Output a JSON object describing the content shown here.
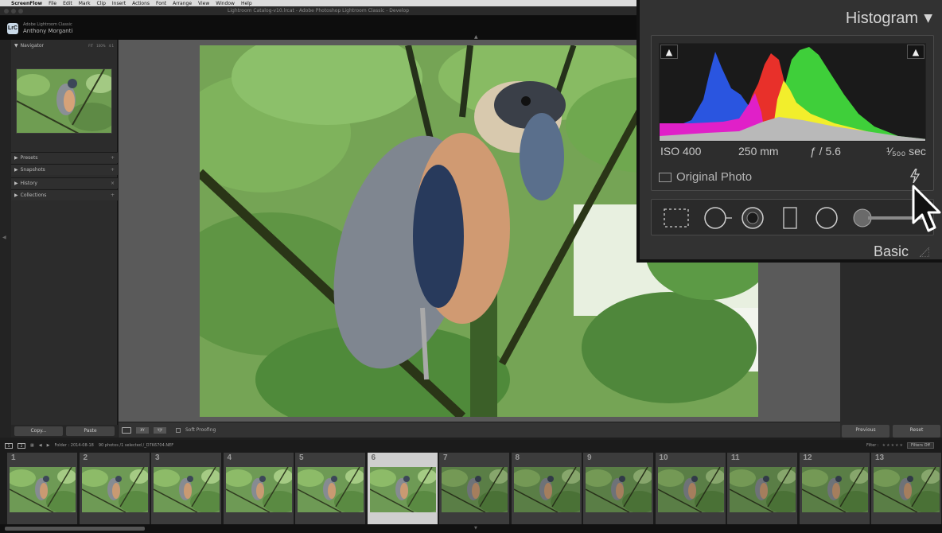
{
  "menubar": {
    "apple": "",
    "app": "ScreenFlow",
    "items": [
      "File",
      "Edit",
      "Mark",
      "Clip",
      "Insert",
      "Actions",
      "Font",
      "Arrange",
      "View",
      "Window",
      "Help"
    ]
  },
  "window": {
    "title": "Lightroom Catalog-v10.lrcat - Adobe Photoshop Lightroom Classic - Develop"
  },
  "identity": {
    "badge": "LrC",
    "app": "Adobe Lightroom Classic",
    "user": "Anthony Morganti"
  },
  "navigator": {
    "title": "Navigator",
    "zooms": [
      "FIT",
      "100%",
      "4:1"
    ]
  },
  "left_sections": [
    {
      "label": "Presets"
    },
    {
      "label": "Snapshots"
    },
    {
      "label": "History"
    },
    {
      "label": "Collections"
    }
  ],
  "left_buttons": {
    "copy": "Copy...",
    "paste": "Paste"
  },
  "toolbar": {
    "soft_proofing": "Soft Proofing",
    "compare": "XY",
    "survey": "Y|Y"
  },
  "right_buttons": {
    "previous": "Previous",
    "reset": "Reset"
  },
  "histogram": {
    "title": "Histogram",
    "clip_shadow": "▲",
    "clip_highlight": "▲",
    "iso": "ISO 400",
    "focal_length": "250 mm",
    "aperture": "ƒ / 5.6",
    "shutter": "¹⁄₅₀₀ sec",
    "original_photo": "Original Photo",
    "next_panel": "Basic"
  },
  "filmstrip": {
    "folder_text": "Folder : 2014-08-18",
    "count_text": "90 photos /1 selected /_D7K6704.NEF",
    "filter_label": "Filter :",
    "filters_off": "Filters Off",
    "thumbnails": [
      {
        "num": "1",
        "selected": false,
        "dim": false
      },
      {
        "num": "2",
        "selected": false,
        "dim": false
      },
      {
        "num": "3",
        "selected": false,
        "dim": false
      },
      {
        "num": "4",
        "selected": false,
        "dim": false
      },
      {
        "num": "5",
        "selected": false,
        "dim": false
      },
      {
        "num": "6",
        "selected": true,
        "dim": false
      },
      {
        "num": "7",
        "selected": false,
        "dim": true
      },
      {
        "num": "8",
        "selected": false,
        "dim": true
      },
      {
        "num": "9",
        "selected": false,
        "dim": true
      },
      {
        "num": "10",
        "selected": false,
        "dim": true
      },
      {
        "num": "11",
        "selected": false,
        "dim": true
      },
      {
        "num": "12",
        "selected": false,
        "dim": true
      },
      {
        "num": "13",
        "selected": false,
        "dim": true
      }
    ]
  },
  "colors": {
    "histogram_blue": "#2a55e0",
    "histogram_red": "#e8302a",
    "histogram_green": "#3fcf3a",
    "histogram_yellow": "#f2ee2c",
    "histogram_magenta": "#e020c8",
    "histogram_gray": "#b9b9b9",
    "selected_cell": "#cfcfcf"
  }
}
